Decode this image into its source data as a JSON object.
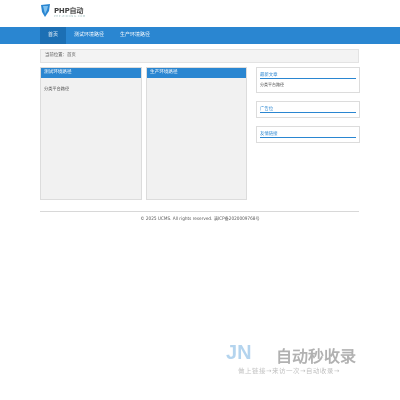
{
  "header": {
    "logo_text": "PHP自动",
    "logo_sub": "PHP·ZIDONG·COM"
  },
  "nav": {
    "items": [
      {
        "label": "首页"
      },
      {
        "label": "测试环境路径"
      },
      {
        "label": "生产环境路径"
      }
    ]
  },
  "breadcrumb": {
    "text": "当前位置：首页"
  },
  "columns": [
    {
      "title": "测试环境路径",
      "body": "分类平台路径"
    },
    {
      "title": "生产环境路径",
      "body": ""
    }
  ],
  "sidebar": {
    "latest": {
      "title": "最新文章",
      "body": "分类平台路径"
    },
    "ads": {
      "title": "广告位"
    },
    "links": {
      "title": "友情链接"
    }
  },
  "footer": {
    "text": "© 2025 UCMS. All rights reserved. 滇ICP备2020009768号"
  },
  "watermark": {
    "logo": "JN",
    "text": "自动秒收录",
    "sub": "做上链接→来访一次→自动收录→"
  },
  "colors": {
    "accent": "#2a86d1",
    "accent_dark": "#1c6fb4"
  },
  "icons": {
    "logo": "php-logo-icon"
  }
}
